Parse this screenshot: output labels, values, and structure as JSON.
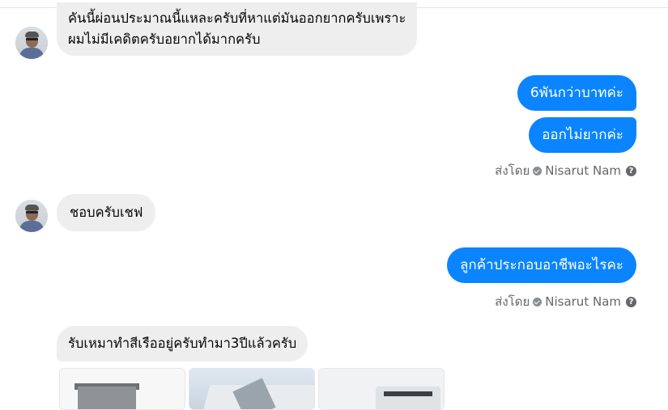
{
  "conversation": {
    "messages": [
      {
        "direction": "in",
        "lines": [
          "คันนี้ผ่อนประมาณนี้แหละครับที่หาแต่มันออกยากครับเพราะ",
          "ผมไม่มีเคดิตครับอยากได้มากครับ"
        ]
      },
      {
        "direction": "out",
        "text": "6พันกว่าบาทค่ะ"
      },
      {
        "direction": "out",
        "text": "ออกไม่ยากค่ะ"
      },
      {
        "direction": "in",
        "text": "ชอบครับเชฟ"
      },
      {
        "direction": "out",
        "text": "ลูกค้าประกอบอาชีพอะไรคะ"
      },
      {
        "direction": "in",
        "text": "รับเหมาทำสีเรืออยู่ครับทำมา3ปีแล้วครับ"
      }
    ],
    "sent_by_label": "ส่งโดย",
    "sent_by_name": "Nisarut Nam",
    "help_glyph": "?"
  },
  "icons": {
    "verified": "check-circle-icon",
    "help": "question-circle-icon"
  },
  "colors": {
    "outgoing_bubble": "#0b84ff",
    "incoming_bubble": "#eeeeee",
    "meta_text": "#65676b"
  }
}
